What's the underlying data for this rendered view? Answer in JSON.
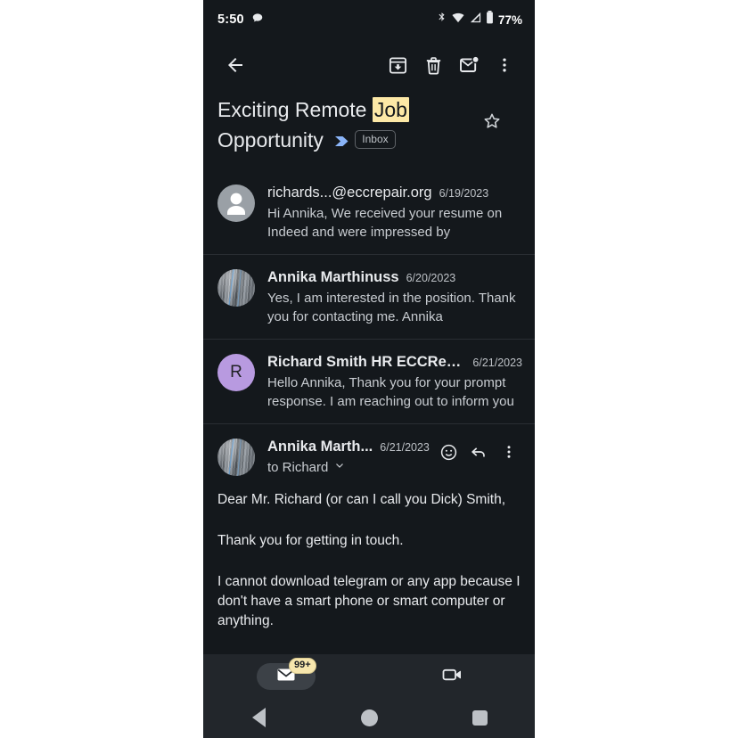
{
  "status_bar": {
    "time": "5:50",
    "chat_icon": "chat-bubble-icon",
    "bluetooth_icon": "bluetooth-icon",
    "wifi_icon": "wifi-icon",
    "signal_icon": "cellular-signal-icon",
    "battery_icon": "battery-icon",
    "battery_percent": "77%"
  },
  "toolbar": {
    "back": "back-arrow",
    "archive": "archive",
    "delete": "delete",
    "mark_unread": "mark-unread",
    "more": "more-options"
  },
  "subject": {
    "part1": "Exciting Remote ",
    "highlight": "Job",
    "part2": "Opportunity",
    "label_chip": "Inbox",
    "star": "star-outline",
    "highlight_color": "#fce8a6",
    "marker_color": "#8ab4f8"
  },
  "messages": [
    {
      "avatar_type": "generic",
      "avatar_text": "",
      "sender": "richards...@eccrepair.org",
      "date": "6/19/2023",
      "snippet": "Hi Annika, We received your resume on Indeed and were impressed by"
    },
    {
      "avatar_type": "photo",
      "avatar_text": "",
      "sender": "Annika Marthinuss",
      "date": "6/20/2023",
      "snippet": "Yes, I am interested in the position. Thank you for contacting me. Annika"
    },
    {
      "avatar_type": "letter",
      "avatar_text": "R",
      "sender": "Richard Smith HR ECCRepai...",
      "date": "6/21/2023",
      "snippet": "Hello Annika, Thank you for your prompt response. I am reaching out to inform you"
    }
  ],
  "expanded_message": {
    "avatar_type": "photo",
    "sender": "Annika Marth...",
    "date": "6/21/2023",
    "recipients": "to Richard",
    "expand_icon": "chevron-down-icon",
    "react_icon": "add-reaction-icon",
    "reply_icon": "reply-icon",
    "more_icon": "more-options-icon",
    "paragraphs": [
      "Dear Mr. Richard (or can I call you Dick) Smith,",
      "Thank you for getting in touch.",
      "I cannot download telegram or any app because I don't have a smart phone or smart computer or anything."
    ]
  },
  "bottom_nav": {
    "mail_tab": "mail-icon",
    "mail_badge": "99+",
    "meet_tab": "video-call-icon",
    "badge_color": "#f7e6ad"
  },
  "system_nav": {
    "back": "back-triangle",
    "home": "home-circle",
    "recents": "recents-square"
  }
}
